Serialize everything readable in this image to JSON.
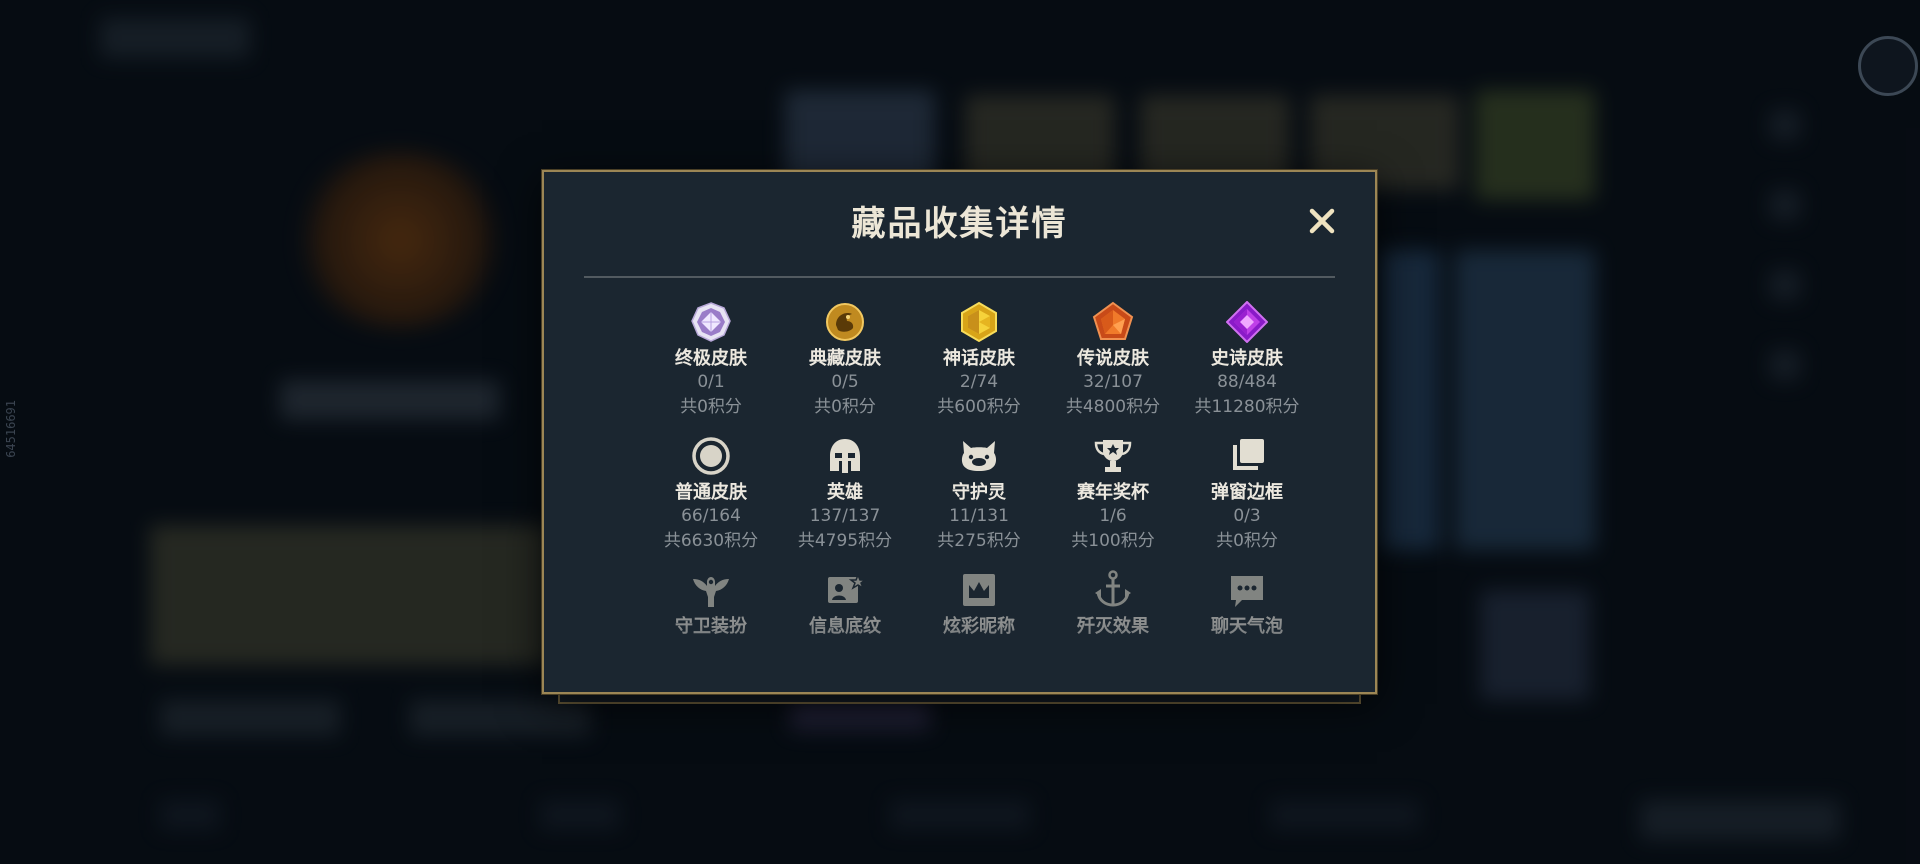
{
  "side_id": "64516691",
  "modal": {
    "title": "藏品收集详情",
    "close_symbol": "✕",
    "rows": [
      [
        {
          "icon": "ultimate-skin-icon",
          "name": "终极皮肤",
          "count": "0/1",
          "points": "共0积分"
        },
        {
          "icon": "prestige-skin-icon",
          "name": "典藏皮肤",
          "count": "0/5",
          "points": "共0积分"
        },
        {
          "icon": "mythic-skin-icon",
          "name": "神话皮肤",
          "count": "2/74",
          "points": "共600积分"
        },
        {
          "icon": "legendary-skin-icon",
          "name": "传说皮肤",
          "count": "32/107",
          "points": "共4800积分"
        },
        {
          "icon": "epic-skin-icon",
          "name": "史诗皮肤",
          "count": "88/484",
          "points": "共11280积分"
        }
      ],
      [
        {
          "icon": "standard-skin-icon",
          "name": "普通皮肤",
          "count": "66/164",
          "points": "共6630积分"
        },
        {
          "icon": "champion-helmet-icon",
          "name": "英雄",
          "count": "137/137",
          "points": "共4795积分"
        },
        {
          "icon": "little-legend-icon",
          "name": "守护灵",
          "count": "11/131",
          "points": "共275积分"
        },
        {
          "icon": "trophy-icon",
          "name": "赛年奖杯",
          "count": "1/6",
          "points": "共100积分"
        },
        {
          "icon": "border-frame-icon",
          "name": "弹窗边框",
          "count": "0/3",
          "points": "共0积分"
        }
      ],
      [
        {
          "icon": "ward-skin-icon",
          "name": "守卫装扮"
        },
        {
          "icon": "banner-card-icon",
          "name": "信息底纹"
        },
        {
          "icon": "crown-nickname-icon",
          "name": "炫彩昵称"
        },
        {
          "icon": "anchor-icon",
          "name": "歼灭效果"
        },
        {
          "icon": "chat-bubble-icon",
          "name": "聊天气泡"
        }
      ]
    ]
  }
}
